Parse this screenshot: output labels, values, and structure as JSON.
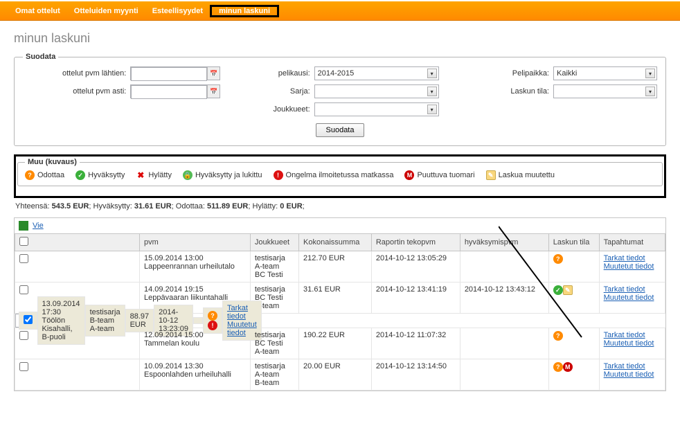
{
  "nav": {
    "tab1": "Omat ottelut",
    "tab2": "Otteluiden myynti",
    "tab3": "Esteellisyydet",
    "tab4": "minun laskuni"
  },
  "page_title": "minun laskuni",
  "filter": {
    "legend": "Suodata",
    "from_lbl": "ottelut pvm lähtien:",
    "to_lbl": "ottelut pvm asti:",
    "season_lbl": "pelikausi:",
    "season_val": "2014-2015",
    "series_lbl": "Sarja:",
    "series_val": "",
    "teams_lbl": "Joukkueet:",
    "teams_val": "",
    "venue_lbl": "Pelipaikka:",
    "venue_val": "Kaikki",
    "state_lbl": "Laskun tila:",
    "state_val": "",
    "submit": "Suodata"
  },
  "legend_box": {
    "title": "Muu (kuvaus)",
    "wait": "Odottaa",
    "ok": "Hyväksytty",
    "rej": "Hylätty",
    "lock": "Hyväksytty ja lukittu",
    "err": "Ongelma ilmoitetussa matkassa",
    "miss": "Puuttuva tuomari",
    "edit": "Laskua muutettu"
  },
  "summary": {
    "tot_lbl": "Yhteensä:",
    "tot_val": "543.5 EUR",
    "ok_lbl": "Hyväksytty:",
    "ok_val": "31.61 EUR",
    "wait_lbl": "Odottaa:",
    "wait_val": "511.89 EUR",
    "rej_lbl": "Hylätty:",
    "rej_val": "0 EUR"
  },
  "vie_lbl": "Vie",
  "cols": {
    "c0": "",
    "c1": "pvm",
    "c2": "Joukkueet",
    "c3": "Kokonaissumma",
    "c4": "Raportin tekopvm",
    "c5": "hyväksymispvm",
    "c6": "Laskun tila",
    "c7": "Tapahtumat"
  },
  "rows": [
    {
      "date": "15.09.2014 13:00",
      "place": "Lappeenrannan urheilutalo",
      "series": "testisarja",
      "team1": "A-team",
      "team2": "BC Testi",
      "total": "212.70 EUR",
      "report": "2014-10-12 13:05:29",
      "approved": "",
      "status": [
        "wait"
      ],
      "checked": false,
      "sel": false
    },
    {
      "date": "14.09.2014 19:15",
      "place": "Leppävaaran liikuntahalli",
      "series": "testisarja",
      "team1": "BC Testi",
      "team2": "B-team",
      "total": "31.61 EUR",
      "report": "2014-10-12 13:41:19",
      "approved": "2014-10-12 13:43:12",
      "status": [
        "ok",
        "edit"
      ],
      "checked": false,
      "sel": false
    },
    {
      "date": "13.09.2014 17:30",
      "place": "Töölön Kisahalli, B-puoli",
      "series": "testisarja",
      "team1": "B-team",
      "team2": "A-team",
      "total": "88.97 EUR",
      "report": "2014-10-12 13:23:09",
      "approved": "",
      "status": [
        "wait",
        "err"
      ],
      "checked": true,
      "sel": true
    },
    {
      "date": "12.09.2014 15:00",
      "place": "Tammelan koulu",
      "series": "testisarja",
      "team1": "BC Testi",
      "team2": "A-team",
      "total": "190.22 EUR",
      "report": "2014-10-12 11:07:32",
      "approved": "",
      "status": [
        "wait"
      ],
      "checked": false,
      "sel": false
    },
    {
      "date": "10.09.2014 13:30",
      "place": "Espoonlahden urheiluhalli",
      "series": "testisarja",
      "team1": "A-team",
      "team2": "B-team",
      "total": "20.00 EUR",
      "report": "2014-10-12 13:14:50",
      "approved": "",
      "status": [
        "wait",
        "miss"
      ],
      "checked": false,
      "sel": false
    }
  ],
  "links": {
    "detail": "Tarkat tiedot",
    "changes": "Muutetut tiedot"
  }
}
